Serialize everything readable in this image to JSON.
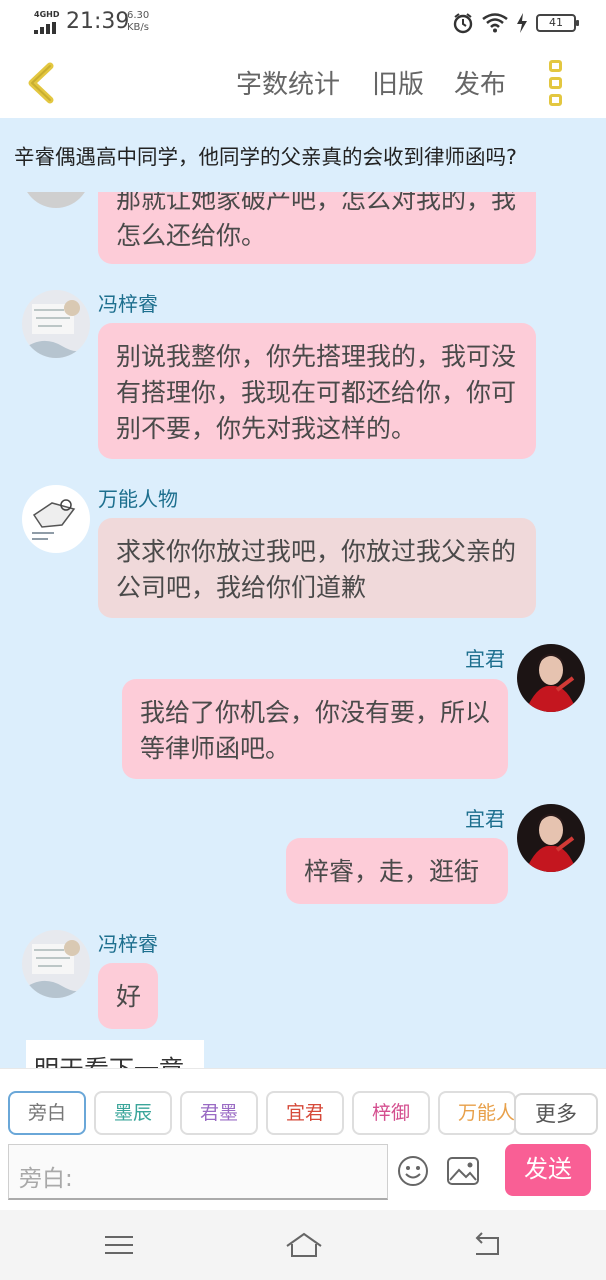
{
  "status_bar": {
    "network": "4GHD",
    "time": "21:39",
    "speed_value": "6.30",
    "speed_unit": "KB/s",
    "battery": "41",
    "icons": [
      "alarm-icon",
      "wifi-icon",
      "charging-icon",
      "battery-icon"
    ]
  },
  "toolbar": {
    "word_count": "字数统计",
    "old_version": "旧版",
    "publish": "发布",
    "icons": [
      "back-arrow-icon",
      "more-menu-icon"
    ],
    "accent_color": "#e3c740"
  },
  "story": {
    "title": "辛睿偶遇高中同学，他同学的父亲真的会收到律师函吗?"
  },
  "messages": [
    {
      "speaker": "",
      "text": "那就让她家破产吧，怎么对我的，我怎么还给你。",
      "side": "left"
    },
    {
      "speaker": "冯梓睿",
      "text": "别说我整你，你先搭理我的，我可没有搭理你，我现在可都还给你，你可别不要，你先对我这样的。",
      "side": "left"
    },
    {
      "speaker": "万能人物",
      "text": "求求你你放过我吧，你放过我父亲的公司吧，我给你们道歉",
      "side": "left"
    },
    {
      "speaker": "宜君",
      "text": "我给了你机会，你没有要，所以等律师函吧。",
      "side": "right"
    },
    {
      "speaker": "宜君",
      "text": "梓睿，走，逛街",
      "side": "right"
    },
    {
      "speaker": "冯梓睿",
      "text": "好",
      "side": "left"
    },
    {
      "speaker": "",
      "text": "明天看下一章",
      "side": "narration"
    }
  ],
  "characters": [
    {
      "label": "旁白",
      "color": "#777777",
      "active": true
    },
    {
      "label": "墨辰",
      "color": "#3aa59a"
    },
    {
      "label": "君墨",
      "color": "#9a6bc4"
    },
    {
      "label": "宜君",
      "color": "#d64a3a"
    },
    {
      "label": "梓御",
      "color": "#d44f8f"
    },
    {
      "label": "万能人物",
      "color": "#e8a04a"
    }
  ],
  "more_label": "更多",
  "input": {
    "placeholder": "旁白:"
  },
  "send_label": "发送",
  "colors": {
    "bubble": "#fdccd8",
    "bubble_alt": "#f0d9da",
    "background": "#dceefc",
    "send": "#f95f95",
    "name": "#1d6f8e"
  },
  "nav_icons": [
    "menu-icon",
    "home-icon",
    "back-icon"
  ]
}
